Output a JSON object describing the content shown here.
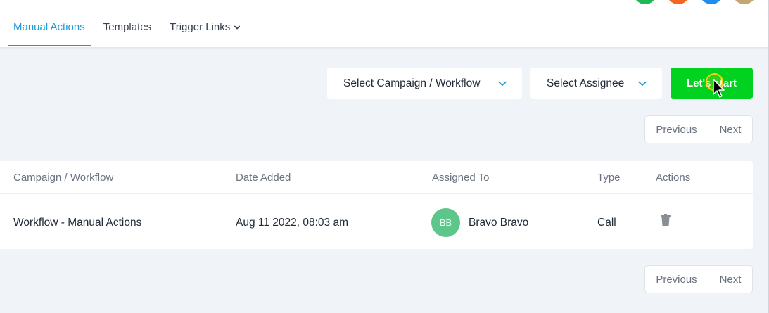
{
  "tabs": [
    {
      "label": "Manual Actions",
      "active": true
    },
    {
      "label": "Templates",
      "active": false
    },
    {
      "label": "Trigger Links",
      "active": false,
      "has_dropdown": true
    }
  ],
  "avatars": [
    {
      "color": "#1db954"
    },
    {
      "color": "#f4661f"
    },
    {
      "color": "#1f8cf0"
    },
    {
      "color": "#c4a574"
    }
  ],
  "filters": {
    "campaign_select": "Select Campaign / Workflow",
    "assignee_select": "Select Assignee",
    "start_button": "Let's start"
  },
  "pagination": {
    "previous": "Previous",
    "next": "Next"
  },
  "table": {
    "columns": [
      "Campaign / Workflow",
      "Date Added",
      "Assigned To",
      "Type",
      "Actions"
    ],
    "rows": [
      {
        "campaign": "Workflow - Manual Actions",
        "date_added": "Aug 11 2022, 08:03 am",
        "assignee_initials": "BB",
        "assignee_name": "Bravo Bravo",
        "type": "Call",
        "action_icon": "trash-icon"
      }
    ]
  },
  "colors": {
    "accent": "#1a9ad6",
    "start_button": "#00d21f",
    "assignee_avatar": "#5dc689",
    "background": "#f0f4f8"
  }
}
